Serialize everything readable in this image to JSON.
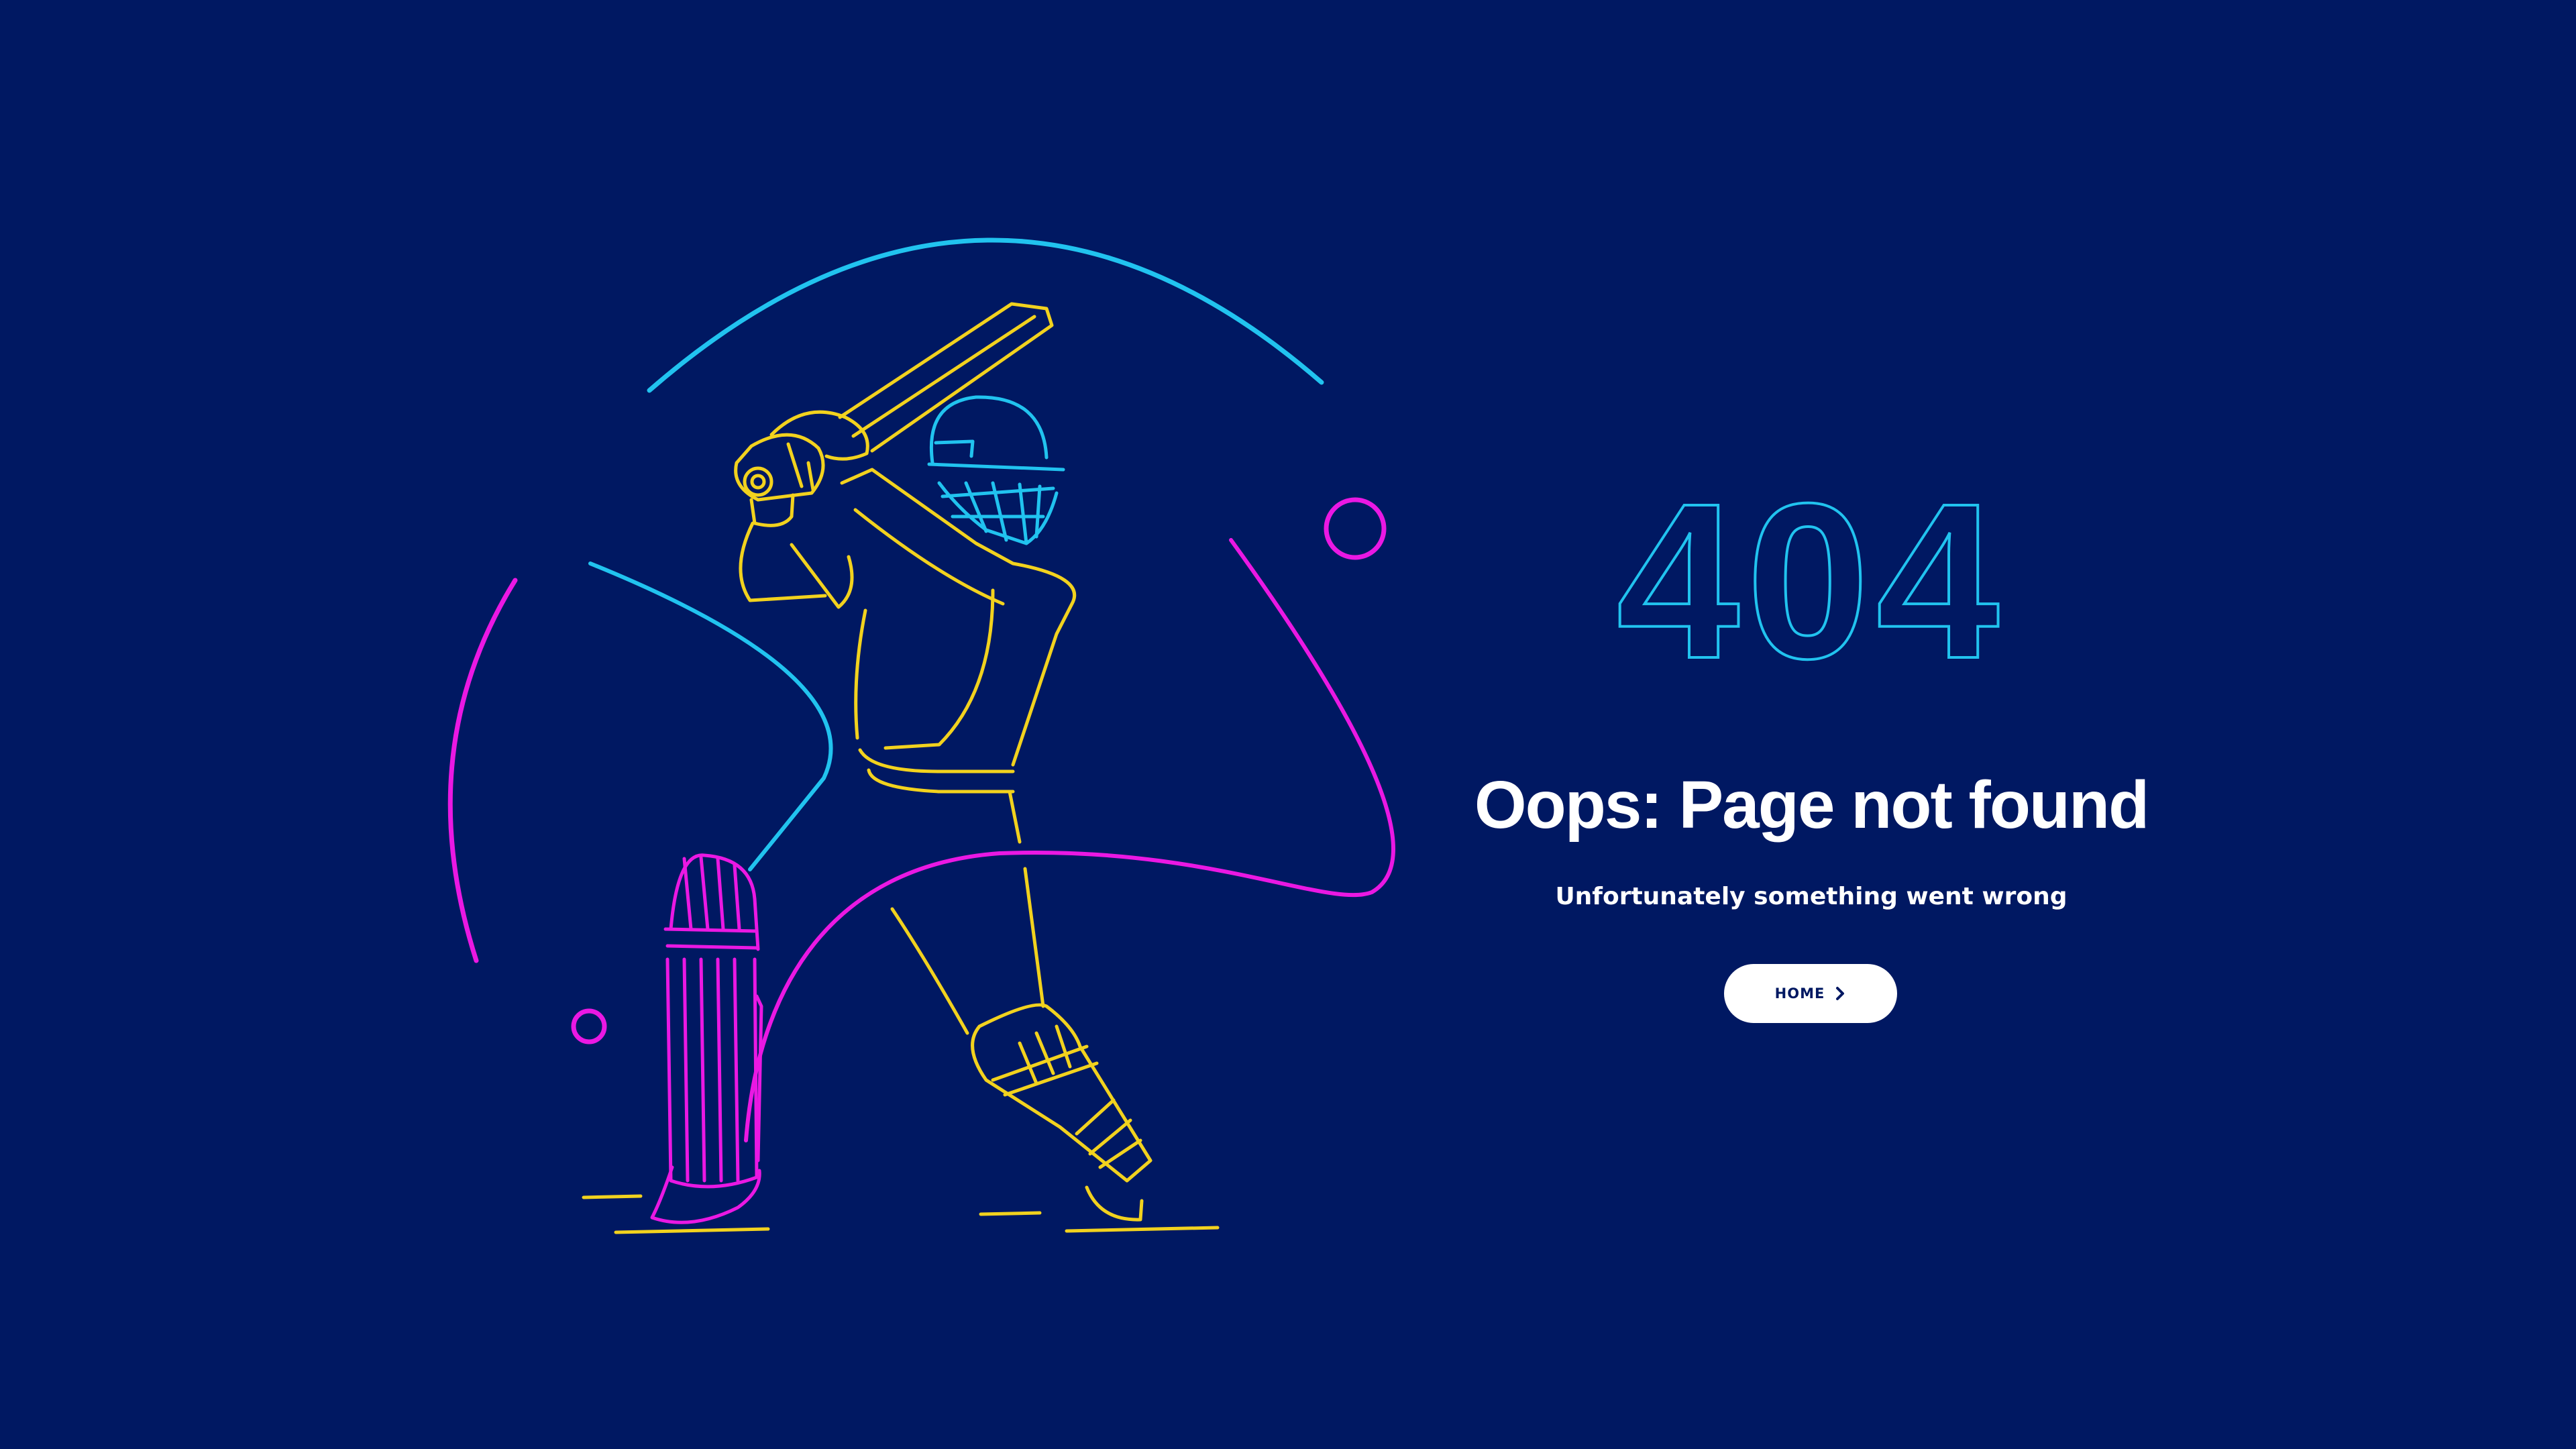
{
  "page": {
    "background_color": "#001862"
  },
  "colors": {
    "yellow": "#f2d21e",
    "cyan": "#21c3ef",
    "magenta": "#ea18e3",
    "white": "#ffffff",
    "navy": "#001862"
  },
  "illustration": {
    "icon": "cricket-batsman-line-art"
  },
  "error": {
    "code": "404",
    "title": "Oops: Page not found",
    "message": "Unfortunately something went wrong"
  },
  "home_button": {
    "label": "HOME",
    "icon": "chevron-right-icon"
  }
}
